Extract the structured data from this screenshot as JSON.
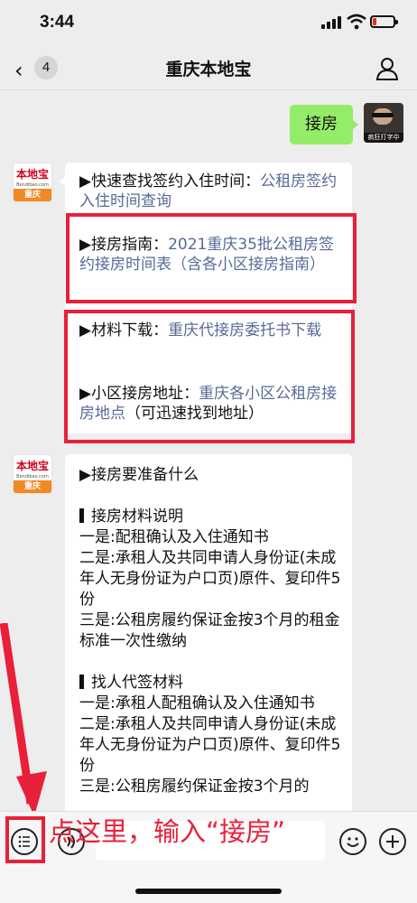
{
  "status_bar": {
    "time": "3:44",
    "battery_level": 0.2,
    "battery_color": "#e02e24"
  },
  "nav": {
    "back_count": "4",
    "title": "重庆本地宝"
  },
  "messages": [
    {
      "side": "right",
      "text": "接房",
      "avatar_caption": "疯狂打字中"
    },
    {
      "side": "left",
      "avatar": {
        "brand": "本地宝",
        "url": "Bendibao.com",
        "city": "重庆"
      },
      "items": [
        {
          "label": "▶快速查找签约入住时间：",
          "link": "公租房签约入住时间查询"
        },
        {
          "label": "▶接房指南：",
          "link": "2021重庆35批公租房签约接房时间表（含各小区接房指南）"
        },
        {
          "label": "▶材料下载：",
          "link": "重庆代接房委托书下载"
        },
        {
          "label": "▶小区接房地址：",
          "link": "重庆各小区公租房接房地点",
          "suffix": "（可迅速找到地址）"
        }
      ]
    },
    {
      "side": "left",
      "avatar": {
        "brand": "本地宝",
        "url": "Bendibao.com",
        "city": "重庆"
      },
      "lines": [
        "▶接房要准备什么",
        "",
        "接房材料说明",
        "一是:配租确认及入住通知书",
        "二是:承租人及共同申请人身份证(未成年人无身份证为户口页)原件、复印件5份",
        "三是:公租房履约保证金按3个月的租金标准一次性缴纳",
        "",
        "找人代签材料",
        "一是:承租人配租确认及入住通知书",
        "二是:承租人及共同申请人身份证(未成年人无身份证为户口页)原件、复印件5份",
        "三是:公租房履约保证金按3个月的"
      ]
    }
  ],
  "annotation": "点这里，输入“接房”",
  "toolbar": {
    "icons": [
      "menu-icon",
      "voice-icon",
      "emoji-icon",
      "plus-icon"
    ]
  },
  "colors": {
    "accent_red": "#e8203a",
    "link": "#576b95",
    "bubble_green": "#95ec69"
  }
}
